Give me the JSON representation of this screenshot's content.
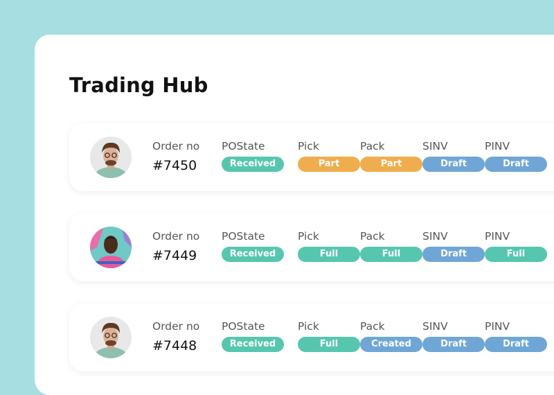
{
  "page": {
    "title": "Trading Hub"
  },
  "colors": {
    "background": "#a6dee1",
    "green": "#56c7ae",
    "orange": "#f0ad4e",
    "blue": "#6fa6d6"
  },
  "columns": {
    "order": "Order no",
    "postate": "POState",
    "pick": "Pick",
    "pack": "Pack",
    "sinv": "SINV",
    "pinv": "PINV"
  },
  "orders": [
    {
      "order_no": "#7450",
      "avatar": "avatar-man-curly-hair-glasses",
      "postate": {
        "label": "Received",
        "color": "green"
      },
      "pick": {
        "label": "Part",
        "color": "orange"
      },
      "pack": {
        "label": "Part",
        "color": "orange"
      },
      "sinv": {
        "label": "Draft",
        "color": "blue"
      },
      "pinv": {
        "label": "Draft",
        "color": "blue"
      }
    },
    {
      "order_no": "#7449",
      "avatar": "avatar-man-pink-shirt",
      "postate": {
        "label": "Received",
        "color": "green"
      },
      "pick": {
        "label": "Full",
        "color": "green"
      },
      "pack": {
        "label": "Full",
        "color": "green"
      },
      "sinv": {
        "label": "Draft",
        "color": "blue"
      },
      "pinv": {
        "label": "Full",
        "color": "green"
      }
    },
    {
      "order_no": "#7448",
      "avatar": "avatar-man-curly-hair-glasses",
      "postate": {
        "label": "Received",
        "color": "green"
      },
      "pick": {
        "label": "Full",
        "color": "green"
      },
      "pack": {
        "label": "Created",
        "color": "blue"
      },
      "sinv": {
        "label": "Draft",
        "color": "blue"
      },
      "pinv": {
        "label": "Draft",
        "color": "blue"
      }
    }
  ]
}
